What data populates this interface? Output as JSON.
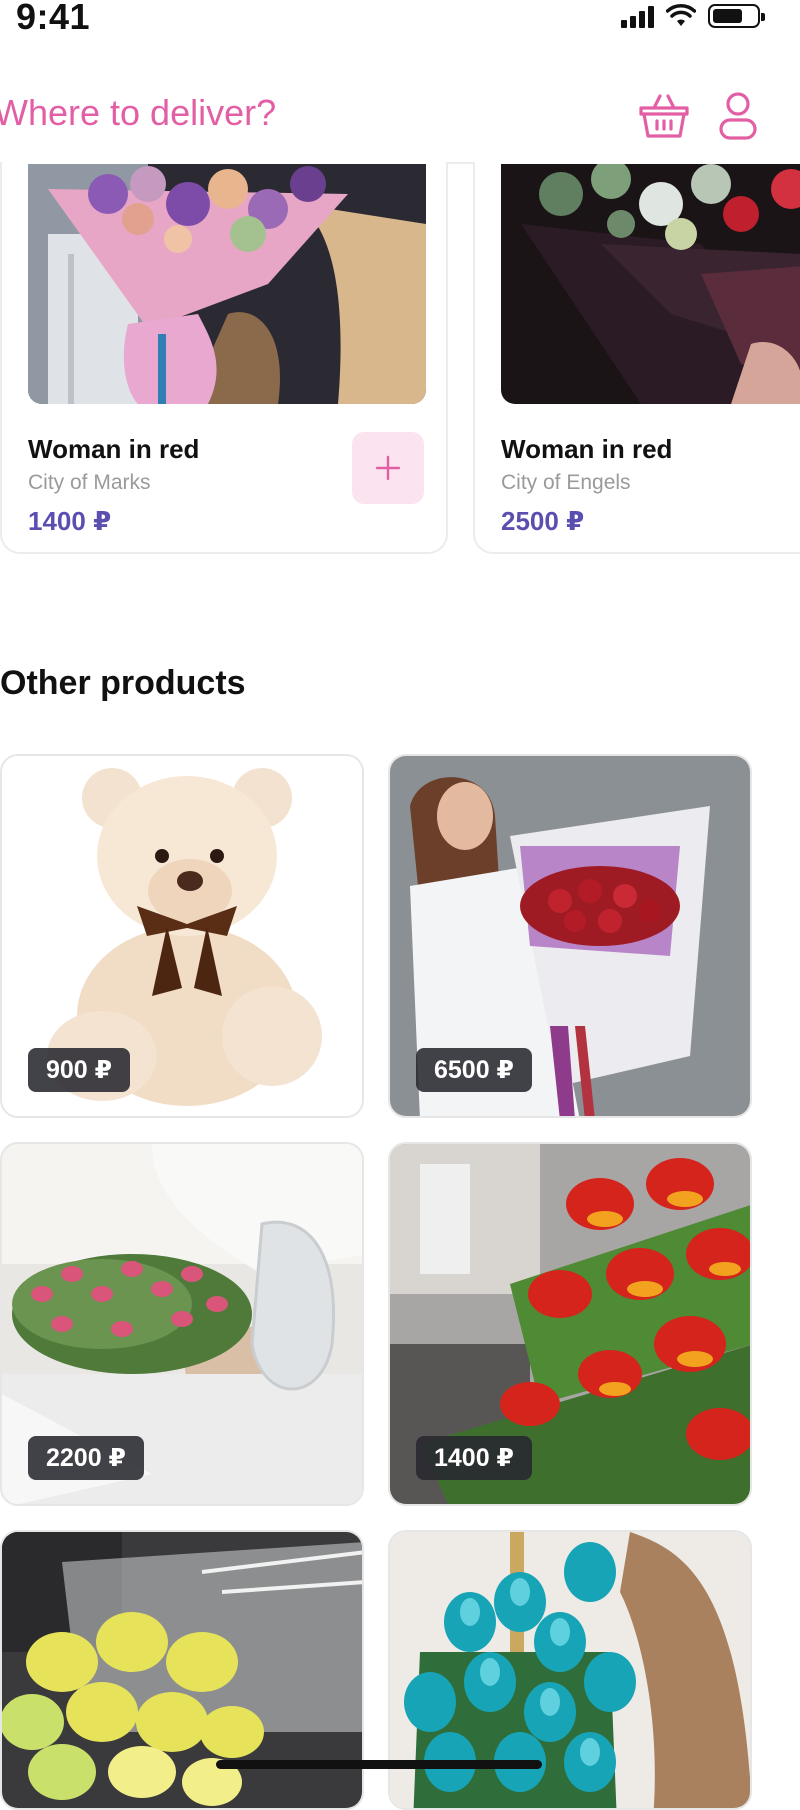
{
  "status_bar": {
    "time": "9:41",
    "signal_icon": "cellular-signal-icon",
    "wifi_icon": "wifi-icon",
    "battery_icon": "battery-icon",
    "battery_level": 0.6
  },
  "header": {
    "deliver_prompt": "Where to deliver?",
    "cart_icon": "basket-icon",
    "profile_icon": "user-icon",
    "accent_color": "#e35fa5"
  },
  "featured": [
    {
      "name": "Woman in red",
      "city": "City of Marks",
      "price": "1400 ₽",
      "add_icon": "plus-icon"
    },
    {
      "name": "Woman in red",
      "city": "City of Engels",
      "price": "2500 ₽"
    }
  ],
  "other_products": {
    "title": "Other products",
    "items": [
      {
        "price": "900 ₽",
        "image": "teddy-bear"
      },
      {
        "price": "6500 ₽",
        "image": "woman-with-rose-bouquet"
      },
      {
        "price": "2200 ₽",
        "image": "pink-tulips"
      },
      {
        "price": "1400 ₽",
        "image": "red-fringed-tulips"
      },
      {
        "price": "",
        "image": "yellow-tulips"
      },
      {
        "price": "",
        "image": "turquoise-tulips"
      }
    ]
  },
  "colors": {
    "price_color": "#5a4fb0",
    "add_button_bg": "#fbe4ef"
  }
}
